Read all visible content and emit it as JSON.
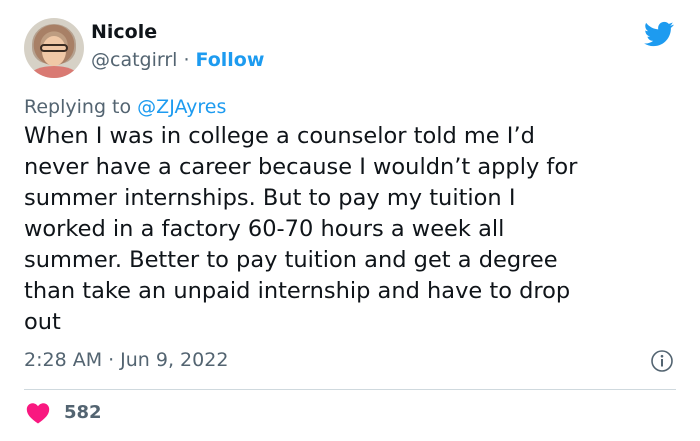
{
  "author": {
    "name": "Nicole",
    "handle": "@catgirrl",
    "separator": "·",
    "follow_label": "Follow"
  },
  "reply": {
    "prefix": "Replying to",
    "mention": "@ZJAyres"
  },
  "tweet": {
    "lines": [
      "When I was in college a counselor told me I’d",
      "never have a career because I wouldn’t apply for",
      "summer internships. But to pay my tuition I",
      "worked in a factory 60-70 hours a week all",
      "summer. Better to pay tuition and get a degree",
      "than take an unpaid internship and have to drop",
      "out"
    ]
  },
  "meta": {
    "time": "2:28 AM",
    "separator": "·",
    "date": "Jun 9, 2022"
  },
  "engagement": {
    "likes": "582"
  },
  "icons": {
    "brand": "twitter-bird-icon",
    "info": "info-icon",
    "like": "heart-icon"
  },
  "colors": {
    "accent": "#1d9bf0",
    "text": "#0f1419",
    "secondary": "#536471",
    "like": "#f91880",
    "divider": "#cfd9de"
  }
}
